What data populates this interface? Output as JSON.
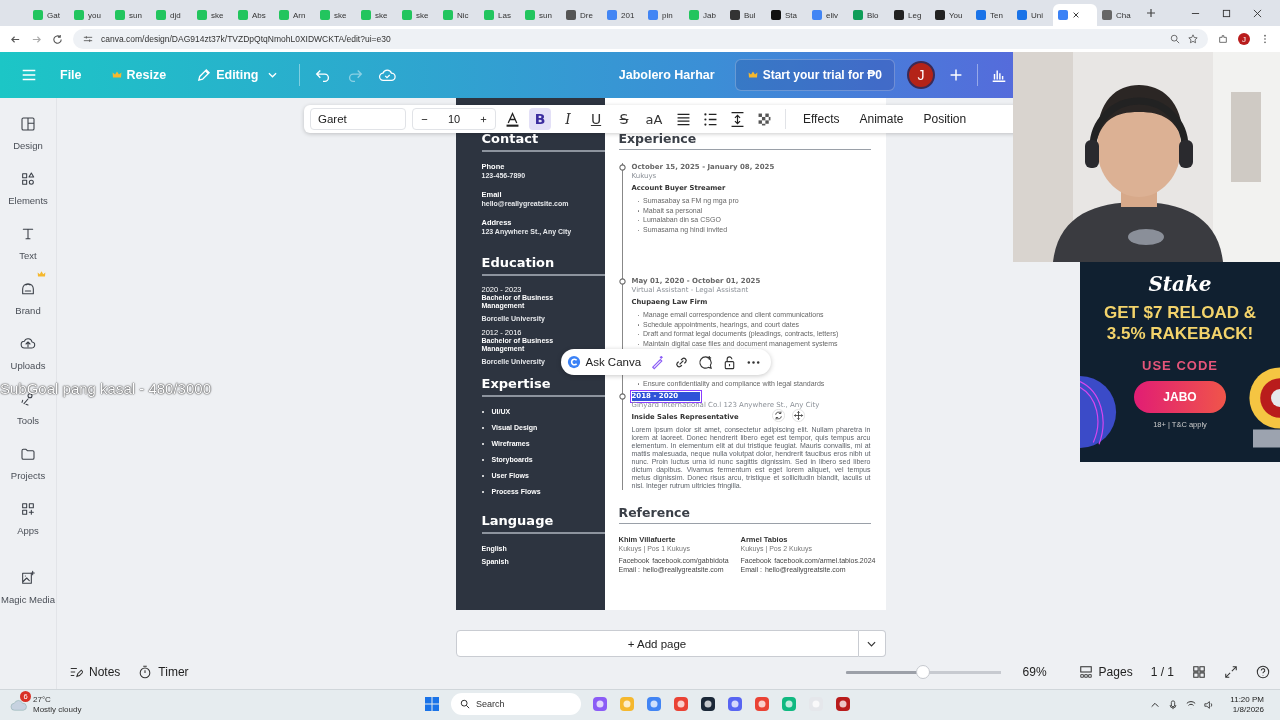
{
  "browser": {
    "tabs": [
      {
        "label": "Gat",
        "color": "#22c55e",
        "selected": false
      },
      {
        "label": "you",
        "color": "#22c55e",
        "selected": false
      },
      {
        "label": "sun",
        "color": "#22c55e",
        "selected": false
      },
      {
        "label": "djd",
        "color": "#22c55e",
        "selected": false
      },
      {
        "label": "ske",
        "color": "#22c55e",
        "selected": false
      },
      {
        "label": "Abs",
        "color": "#22c55e",
        "selected": false
      },
      {
        "label": "Arn",
        "color": "#22c55e",
        "selected": false
      },
      {
        "label": "ske",
        "color": "#22c55e",
        "selected": false
      },
      {
        "label": "ske",
        "color": "#22c55e",
        "selected": false
      },
      {
        "label": "ske",
        "color": "#22c55e",
        "selected": false
      },
      {
        "label": "Nic",
        "color": "#22c55e",
        "selected": false
      },
      {
        "label": "Las",
        "color": "#22c55e",
        "selected": false
      },
      {
        "label": "sun",
        "color": "#22c55e",
        "selected": false
      },
      {
        "label": "Dre",
        "color": "#555555",
        "selected": false
      },
      {
        "label": "201",
        "color": "#4285f4",
        "selected": false
      },
      {
        "label": "pin",
        "color": "#4285f4",
        "selected": false
      },
      {
        "label": "Jab",
        "color": "#22c55e",
        "selected": false
      },
      {
        "label": "Bul",
        "color": "#333333",
        "selected": false
      },
      {
        "label": "Sta",
        "color": "#111111",
        "selected": false
      },
      {
        "label": "eliv",
        "color": "#4285f4",
        "selected": false
      },
      {
        "label": "Blo",
        "color": "#0f9d58",
        "selected": false
      },
      {
        "label": "Leg",
        "color": "#222222",
        "selected": false
      },
      {
        "label": "You",
        "color": "#222222",
        "selected": false
      },
      {
        "label": "Ten",
        "color": "#1a73e8",
        "selected": false
      },
      {
        "label": "Uni",
        "color": "#1a73e8",
        "selected": false
      },
      {
        "color": "#3b82f6",
        "selected": true
      },
      {
        "label": "Cha",
        "color": "#666666",
        "selected": false
      }
    ],
    "address": "canva.com/design/DAG914zt37k/TVZDpQtqNmohL0XIDWCKTA/edit?ui=e30",
    "profile": "J"
  },
  "header": {
    "file": "File",
    "resize": "Resize",
    "mode": "Editing",
    "user_name": "Jabolero Harhar",
    "trial": "Start your trial for ₱0",
    "avatar": "J"
  },
  "sidebar": {
    "items": [
      {
        "label": "Design",
        "premium": false
      },
      {
        "label": "Elements",
        "premium": false
      },
      {
        "label": "Text",
        "premium": false
      },
      {
        "label": "Brand",
        "premium": true
      },
      {
        "label": "Uploads",
        "premium": false
      },
      {
        "label": "Tools",
        "premium": false
      },
      {
        "label": "Projects",
        "premium": false
      },
      {
        "label": "Apps",
        "premium": false
      },
      {
        "label": "Magic Media",
        "premium": false
      }
    ]
  },
  "text_toolbar": {
    "font": "Garet",
    "size": "10",
    "format_buttons": [
      {
        "label": "B",
        "selected": true
      },
      {
        "label": "I",
        "selected": false
      },
      {
        "label": "U",
        "selected": false
      },
      {
        "label": "S",
        "selected": false
      }
    ],
    "case_button": "aA",
    "actions": [
      "Effects",
      "Animate",
      "Position"
    ]
  },
  "resume": {
    "contact": {
      "heading": "Contact",
      "items": [
        {
          "label": "Phone",
          "value": "123-456-7890"
        },
        {
          "label": "Email",
          "value": "hello@reallygreatsite.com"
        },
        {
          "label": "Address",
          "value": "123 Anywhere St., Any City"
        }
      ]
    },
    "education": {
      "heading": "Education",
      "items": [
        {
          "years": "2020 - 2023",
          "degree": "Bachelor of Business Management",
          "school": "Borcelle University"
        },
        {
          "years": "2012 - 2016",
          "degree": "Bachelor of Business Management",
          "school": "Borcelle University"
        }
      ]
    },
    "expertise": {
      "heading": "Expertise",
      "items": [
        "UI/UX",
        "Visual Design",
        "Wireframes",
        "Storyboards",
        "User Flows",
        "Process Flows"
      ]
    },
    "language": {
      "heading": "Language",
      "items": [
        "English",
        "Spanish"
      ]
    },
    "experience": {
      "heading": "Experience",
      "items": [
        {
          "dates": "October 15, 2025 - January 08, 2025",
          "subtitle": "Kukuys",
          "title": "Account Buyer Streamer",
          "text_selected": false,
          "bullets": [
            "Sumasabay sa FM ng mga pro",
            "Mabait sa personal",
            "Lumalaban din sa CSGO",
            "Sumasama ng hindi invited"
          ]
        },
        {
          "dates": "May 01, 2020 - October 01, 2025",
          "subtitle": "Virtual Assistant - Legal Assistant",
          "title": "Chupaeng Law Firm",
          "text_selected": false,
          "bullets": [
            "Manage email correspondence and client communications",
            "Schedule appointments, hearings, and court dates",
            "Draft and format legal documents (pleadings, contracts, letters)",
            "Maintain digital case files and document management systems",
            "Ensure confidentiality and compliance with legal standards"
          ]
        },
        {
          "dates": "2018 - 2020",
          "subtitle": "Ginyard International Co.l 123 Anywhere St., Any City",
          "title": "Inside Sales Representative",
          "text_selected": true,
          "paragraph": "Lorem ipsum dolor sit amet, consectetur adipiscing elit. Nullam pharetra in lorem at laoreet. Donec hendrerit libero eget est tempor, quis tempus arcu elementum. In elementum elit at dui tristique feugiat. Mauris convallis, mi at mattis malesuada, neque nulla volutpat dolor, hendrerit faucibus eros nibh ut nunc. Proin luctus urna id nunc sagittis dignissim. Sed in libero sed libero dictum dapibus. Vivamus fermentum est eget lorem aliquet, vel tempus metus dignissim. Donec risus arcu, tristique et sollicitudin blandit, iaculis ut nisl. Integer rutrum ultricies fringilla."
        }
      ]
    },
    "reference": {
      "heading": "Reference",
      "items": [
        {
          "name": "Khim Villafuerte",
          "position": "Kukuys | Pos 1 Kukuys",
          "facebook_label": "Facebook",
          "facebook": "facebook.com/gabbidota",
          "email_label": "Email :",
          "email": "hello@reallygreatsite.com"
        },
        {
          "name": "Armel Tabios",
          "position": "Kukuys | Pos 2 Kukuys",
          "facebook_label": "Facebook",
          "facebook": "facebook.com/armel.tabios.2024",
          "email_label": "Email :",
          "email": "hello@reallygreatsite.com"
        }
      ]
    }
  },
  "element_toolbar": {
    "ask": "Ask Canva"
  },
  "add_page": "+ Add page",
  "bottom_bar": {
    "notes": "Notes",
    "timer": "Timer",
    "zoom": {
      "level": 0.5,
      "reading": "69%"
    },
    "pages": "Pages",
    "page_count": "1 / 1"
  },
  "taskbar": {
    "weather": {
      "temperature": "27°C",
      "condition": "Mostly cloudy",
      "badge": "6"
    },
    "search": "Search",
    "time": "11:20 PM",
    "date": "1/8/2026"
  },
  "stream_overlay": {
    "goal_text": "SubGoal pang kasal - 480/3000",
    "ad": {
      "brand": "Stake",
      "headline": "GET $7 RELOAD & 3.5% RAKEBACK!",
      "cta": "USE CODE",
      "code": "JABO",
      "terms": "18+ | T&C apply"
    }
  }
}
